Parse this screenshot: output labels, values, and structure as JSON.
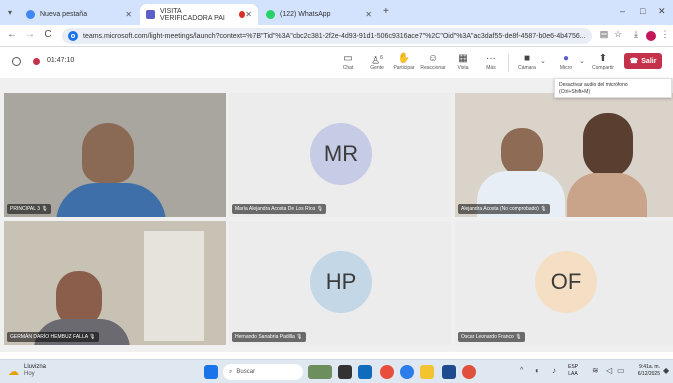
{
  "browser": {
    "tabs": [
      {
        "label": "Nueva pestaña",
        "active": false,
        "icon": "chrome-icon"
      },
      {
        "label": "VISITA VERIFICADORA PAI",
        "active": true,
        "icon": "teams-icon"
      },
      {
        "label": "(122) WhatsApp",
        "active": false,
        "icon": "whatsapp-icon"
      }
    ],
    "new_tab": "+",
    "url": "teams.microsoft.com/light-meetings/launch?context=%7B\"Tid\"%3A\"cbc2c381-2f2e-4d93-91d1-506c9316ace7\"%2C\"Oid\"%3A\"ac3daf55-de8f-4587-b0e6-4b4756...",
    "window_controls": {
      "minimize": "–",
      "restore": "□",
      "close": "✕"
    }
  },
  "meeting": {
    "timer": "01:47:10",
    "toolbar": [
      {
        "label": "Chat",
        "icon": "chat-icon",
        "glyph": "☺"
      },
      {
        "label": "Gente",
        "icon": "people-icon",
        "glyph": "♙",
        "badge": "6"
      },
      {
        "label": "Participar",
        "icon": "raise-hand-icon",
        "glyph": "✋"
      },
      {
        "label": "Reaccionar",
        "icon": "reaction-icon",
        "glyph": "☺"
      },
      {
        "label": "Vista",
        "icon": "view-icon",
        "glyph": "▦"
      },
      {
        "label": "Más",
        "icon": "more-icon",
        "glyph": "···"
      },
      {
        "label": "Cámara",
        "icon": "camera-icon",
        "glyph": "■"
      },
      {
        "label": "Micro",
        "icon": "mic-icon",
        "glyph": "🎙"
      },
      {
        "label": "Compartir",
        "icon": "share-icon",
        "glyph": "⬆"
      }
    ],
    "leave_label": "Salir",
    "tooltip": {
      "line1": "Desactivar audio del micrófono",
      "line2": "(Ctrl+Shift+M)"
    }
  },
  "participants": [
    {
      "name": "PRINCIPAL 3",
      "type": "video",
      "initials": ""
    },
    {
      "name": "María Alejandra Acosta De Los Ríos",
      "type": "avatar",
      "initials": "MR",
      "color": "#c7cce6"
    },
    {
      "name": "Alejandra Acosta (No comprobado)",
      "type": "video",
      "initials": ""
    },
    {
      "name": "GERMÁN DARÍO HEMBUZ FALLA",
      "type": "video",
      "initials": ""
    },
    {
      "name": "Hernando Sanabria Padilla",
      "type": "avatar",
      "initials": "HP",
      "color": "#c4d7e6"
    },
    {
      "name": "Oscar Leonardo Franco",
      "type": "avatar",
      "initials": "OF",
      "color": "#f5dfc4"
    }
  ],
  "taskbar": {
    "weather_title": "Lluvizna",
    "weather_sub": "Hoy",
    "search_placeholder": "Buscar",
    "lang_top": "ESP",
    "lang_bottom": "LAA",
    "time": "9:41a. m.",
    "date": "6/12/2025"
  }
}
